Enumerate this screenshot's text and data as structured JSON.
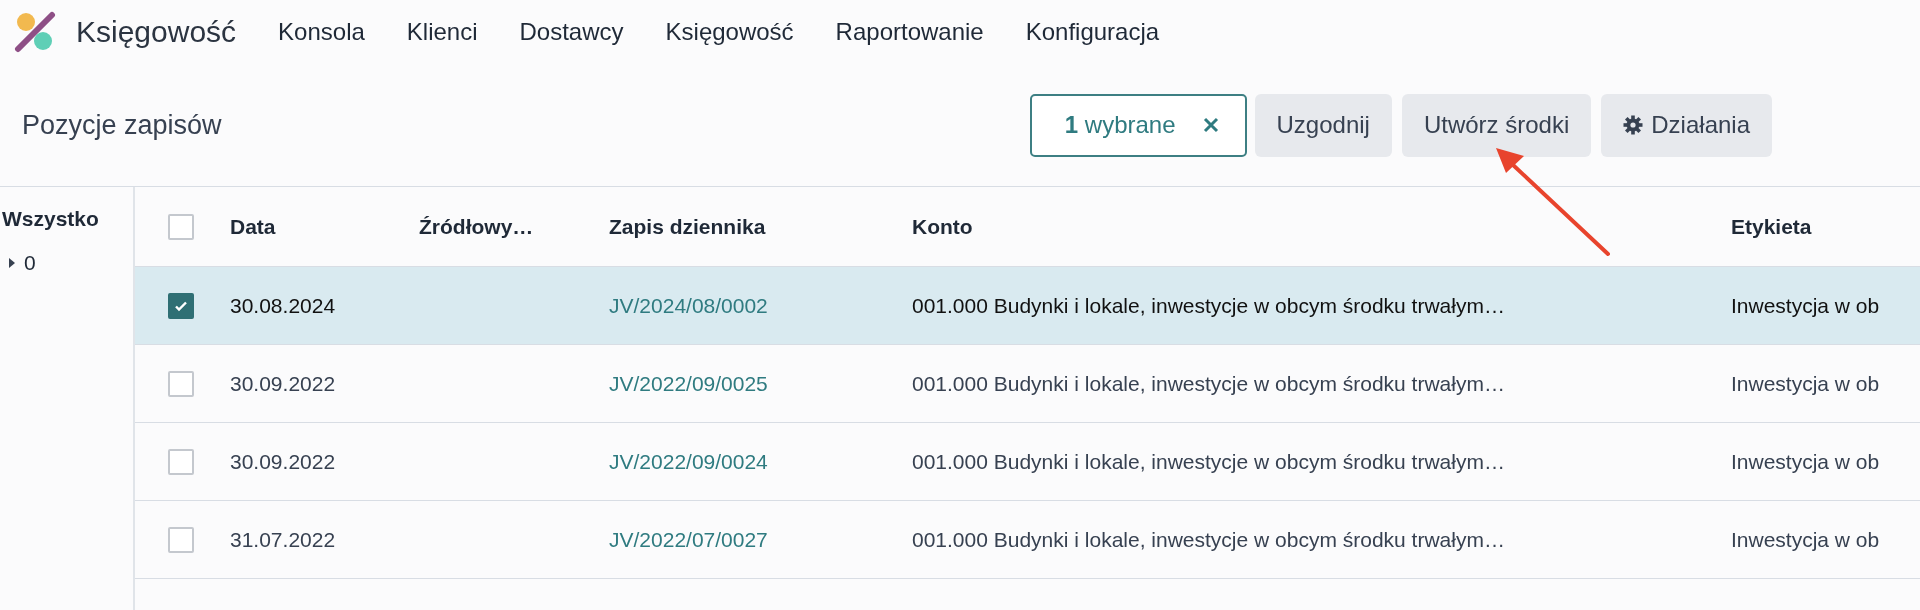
{
  "app": {
    "name": "Księgowość"
  },
  "menu": [
    {
      "label": "Konsola"
    },
    {
      "label": "Klienci"
    },
    {
      "label": "Dostawcy"
    },
    {
      "label": "Księgowość"
    },
    {
      "label": "Raportowanie"
    },
    {
      "label": "Konfiguracja"
    }
  ],
  "control_panel": {
    "title": "Pozycje zapisów",
    "selection": {
      "count": "1",
      "label": "wybrane"
    },
    "buttons": [
      {
        "label": "Uzgodnij",
        "kind": "plain"
      },
      {
        "label": "Utwórz środki",
        "kind": "plain"
      },
      {
        "label": "Działania",
        "kind": "gear"
      }
    ]
  },
  "sidebar": {
    "title": "Wszystko",
    "items": [
      {
        "label": "0",
        "expanded": false
      }
    ]
  },
  "table": {
    "select_all": {
      "checked": false
    },
    "columns": [
      "Data",
      "Źródłowy…",
      "Zapis dziennika",
      "Konto",
      "Etykieta"
    ],
    "rows": [
      {
        "selected": true,
        "cells": [
          "30.08.2024",
          "",
          "JV/2024/08/0002",
          "001.000 Budynki i lokale, inwestycje w obcym środku trwałym…",
          "Inwestycja w ob"
        ]
      },
      {
        "selected": false,
        "cells": [
          "30.09.2022",
          "",
          "JV/2022/09/0025",
          "001.000 Budynki i lokale, inwestycje w obcym środku trwałym…",
          "Inwestycja w ob"
        ]
      },
      {
        "selected": false,
        "cells": [
          "30.09.2022",
          "",
          "JV/2022/09/0024",
          "001.000 Budynki i lokale, inwestycje w obcym środku trwałym…",
          "Inwestycja w ob"
        ]
      },
      {
        "selected": false,
        "cells": [
          "31.07.2022",
          "",
          "JV/2022/07/0027",
          "001.000 Budynki i lokale, inwestycje w obcym środku trwałym…",
          "Inwestycja w ob"
        ]
      }
    ]
  }
}
